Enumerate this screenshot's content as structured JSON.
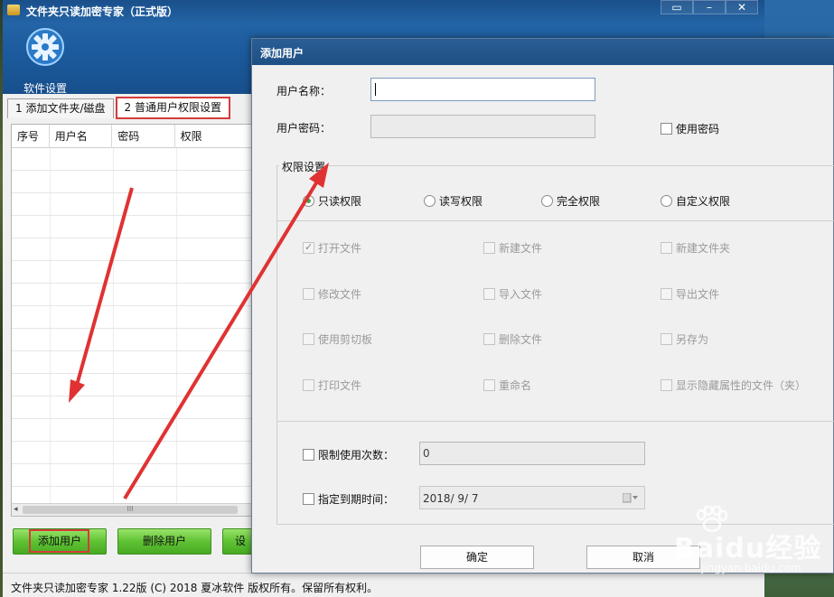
{
  "main": {
    "title": "文件夹只读加密专家（正式版）",
    "window_controls": [
      "▭",
      "–",
      "✕"
    ],
    "settings_label": "软件设置",
    "tabs": [
      "1 添加文件夹/磁盘",
      "2 普通用户权限设置"
    ],
    "table_headers": [
      "序号",
      "用户名",
      "密码",
      "权限"
    ],
    "scroll_glyph": "◂",
    "scroll_thumb_glyph": "III",
    "buttons": {
      "add": "添加用户",
      "delete": "删除用户",
      "third": "设"
    },
    "status": "文件夹只读加密专家 1.22版 (C) 2018 夏冰软件 版权所有。保留所有权利。"
  },
  "dialog": {
    "title": "添加用户",
    "username_label": "用户名称：",
    "username_value": "",
    "password_label": "用户密码：",
    "password_value": "",
    "use_password_label": "使用密码",
    "perm_legend": "权限设置",
    "perm_modes": [
      {
        "label": "只读权限",
        "selected": true
      },
      {
        "label": "读写权限",
        "selected": false
      },
      {
        "label": "完全权限",
        "selected": false
      },
      {
        "label": "自定义权限",
        "selected": false
      }
    ],
    "perms": [
      {
        "label": "打开文件",
        "checked": true
      },
      {
        "label": "新建文件",
        "checked": false
      },
      {
        "label": "新建文件夹",
        "checked": false
      },
      {
        "label": "修改文件",
        "checked": false
      },
      {
        "label": "导入文件",
        "checked": false
      },
      {
        "label": "导出文件",
        "checked": false
      },
      {
        "label": "使用剪切板",
        "checked": false
      },
      {
        "label": "删除文件",
        "checked": false
      },
      {
        "label": "另存为",
        "checked": false
      },
      {
        "label": "打印文件",
        "checked": false
      },
      {
        "label": "重命名",
        "checked": false
      },
      {
        "label": "显示隐藏属性的文件（夹）",
        "checked": false
      }
    ],
    "limit_uses_label": "限制使用次数：",
    "limit_uses_value": "0",
    "expiry_label": "指定到期时间：",
    "expiry_value": "2018/ 9/ 7",
    "ok_label": "确定",
    "cancel_label": "取消"
  },
  "watermark": {
    "text": "Baidu经验",
    "sub": "jingyan.baidu.com"
  },
  "colors": {
    "highlight": "#d63b3b",
    "green_button": "#5fc234",
    "title_blue": "#1e4f84"
  }
}
